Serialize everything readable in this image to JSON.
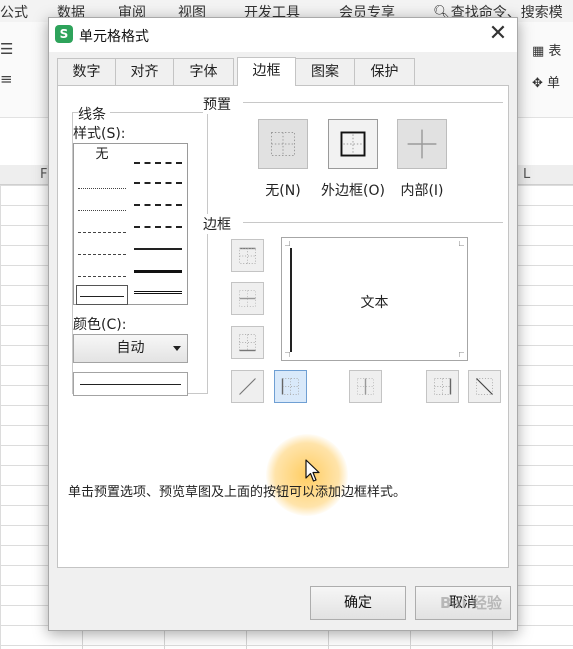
{
  "ribbon": {
    "tabs": [
      "公式",
      "数据",
      "审阅",
      "视图",
      "开发工具",
      "会员专享"
    ],
    "search_label": "查找命令、搜索模"
  },
  "toolbar": {
    "right_items": [
      "表",
      "单"
    ]
  },
  "sheet": {
    "column_labels": [
      "F",
      "L"
    ]
  },
  "dialog": {
    "title": "单元格格式",
    "tabs": [
      "数字",
      "对齐",
      "字体",
      "边框",
      "图案",
      "保护"
    ],
    "active_tab": "边框",
    "lines_group": {
      "label": "线条",
      "style_label": "样式(S):",
      "none_option": "无",
      "color_label": "颜色(C):",
      "color_value": "自动"
    },
    "presets_group": {
      "label": "预置",
      "items": [
        "无(N)",
        "外边框(O)",
        "内部(I)"
      ]
    },
    "border_group": {
      "label": "边框",
      "preview_text": "文本"
    },
    "hint": "单击预置选项、预览草图及上面的按钮可以添加边框样式。",
    "ok_label": "确定",
    "cancel_label": "取消"
  },
  "watermark": "Bai 经验",
  "colors": {
    "accent_selected": "#d9e9fa",
    "app_icon": "#2ea35b",
    "cursor_halo": "#ffc446"
  }
}
